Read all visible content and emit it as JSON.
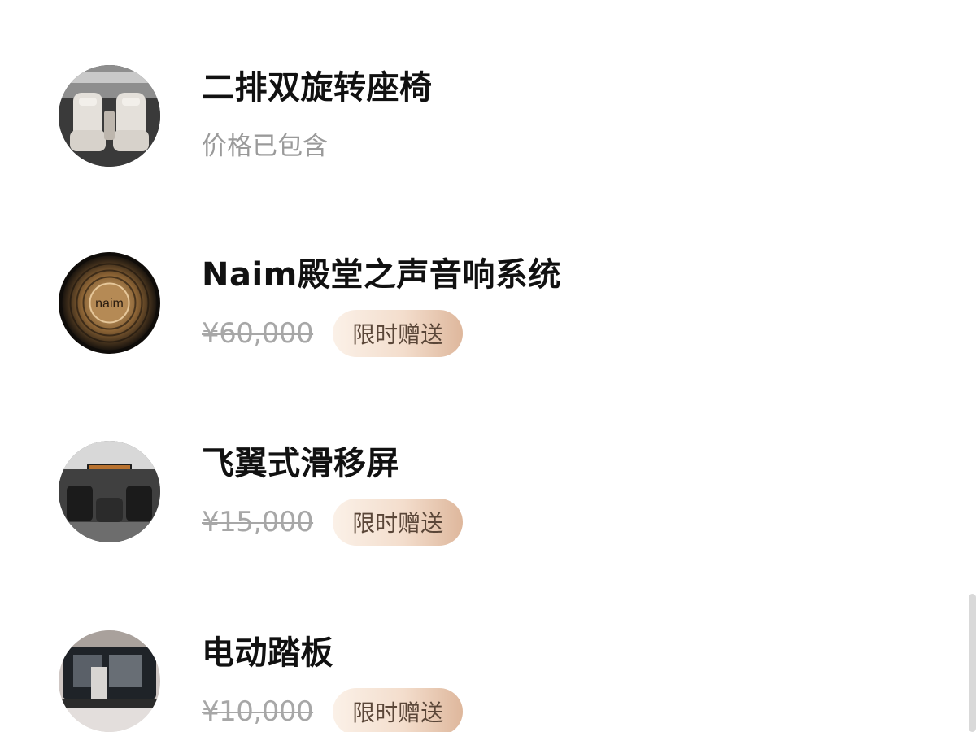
{
  "items": [
    {
      "title": "二排双旋转座椅",
      "subtitle": "价格已包含",
      "icon": "rotating-seat-icon"
    },
    {
      "title": "Naim殿堂之声音响系统",
      "price": "¥60,000",
      "badge": "限时赠送",
      "icon": "naim-speaker-icon",
      "logo_text": "naim"
    },
    {
      "title": "飞翼式滑移屏",
      "price": "¥15,000",
      "badge": "限时赠送",
      "icon": "sliding-screen-icon"
    },
    {
      "title": "电动踏板",
      "price": "¥10,000",
      "badge": "限时赠送",
      "icon": "power-step-icon"
    }
  ],
  "colors": {
    "title": "#111111",
    "subtitle": "#9a9a9a",
    "price": "#a7a7a7",
    "badge_text": "#5a4638",
    "badge_start": "#fbf1e8",
    "badge_end": "#deb79c"
  }
}
